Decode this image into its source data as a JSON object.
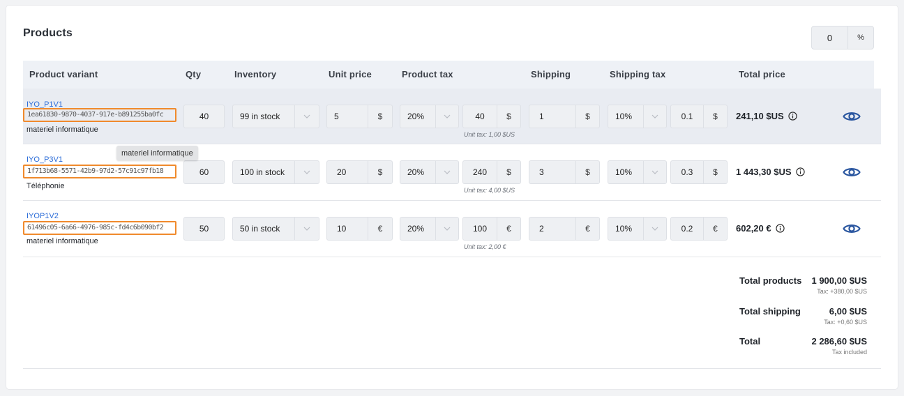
{
  "section": {
    "title": "Products"
  },
  "discount": {
    "value": "0",
    "unit": "%"
  },
  "columns": [
    "Product variant",
    "Qty",
    "Inventory",
    "Unit price",
    "Product tax",
    "Shipping",
    "Shipping tax",
    "Total price"
  ],
  "rows": [
    {
      "variant_name": "IYO_P1V1",
      "variant_id": "1ea61830-9870-4037-917e-b891255ba0fc",
      "category": "materiel informatique",
      "qty": "40",
      "inventory": "99 in stock",
      "unit_price": "5",
      "currency": "$",
      "product_tax_rate": "20%",
      "product_tax_amount": "40",
      "unit_tax": "Unit tax: 1,00 $US",
      "shipping": "1",
      "shipping_tax_rate": "10%",
      "shipping_tax_amount": "0.1",
      "total": "241,10 $US"
    },
    {
      "variant_name": "IYO_P3V1",
      "variant_id": "1f713b68-5571-42b9-97d2-57c91c97fb18",
      "category": "Téléphonie",
      "qty": "60",
      "inventory": "100 in stock",
      "unit_price": "20",
      "currency": "$",
      "product_tax_rate": "20%",
      "product_tax_amount": "240",
      "unit_tax": "Unit tax: 4,00 $US",
      "shipping": "3",
      "shipping_tax_rate": "10%",
      "shipping_tax_amount": "0.3",
      "total": "1 443,30 $US"
    },
    {
      "variant_name": "IYOP1V2",
      "variant_id": "61496c05-6a66-4976-985c-fd4c6b090bf2",
      "category": "materiel informatique",
      "qty": "50",
      "inventory": "50 in stock",
      "unit_price": "10",
      "currency": "€",
      "product_tax_rate": "20%",
      "product_tax_amount": "100",
      "unit_tax": "Unit tax: 2,00 €",
      "shipping": "2",
      "shipping_tax_rate": "10%",
      "shipping_tax_amount": "0.2",
      "total": "602,20 €"
    }
  ],
  "tooltip": "materiel informatique",
  "summary": {
    "products_label": "Total products",
    "products_value": "1 900,00 $US",
    "products_tax": "Tax: +380,00 $US",
    "shipping_label": "Total shipping",
    "shipping_value": "6,00 $US",
    "shipping_tax": "Tax: +0,60 $US",
    "total_label": "Total",
    "total_value": "2 286,60 $US",
    "total_note": "Tax included"
  },
  "colors": {
    "accent": "#2b6cd8",
    "highlight": "#f08a2c",
    "eye_icon": "#2b57a0"
  },
  "icons": [
    "chevron-down-icon",
    "info-icon",
    "eye-icon"
  ]
}
